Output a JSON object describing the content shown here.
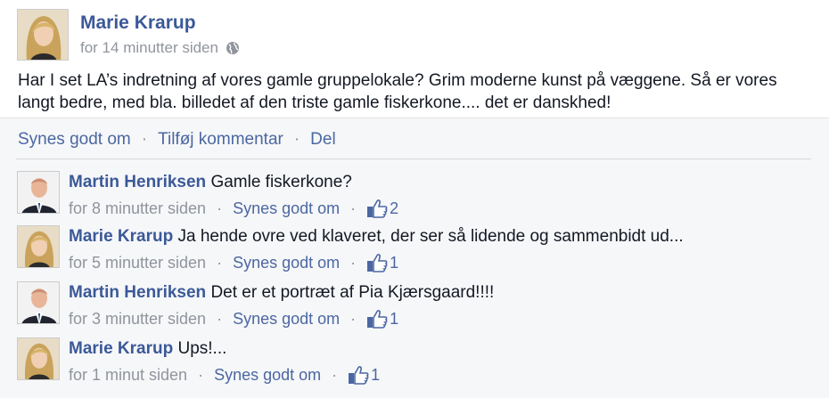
{
  "post": {
    "author": "Marie Krarup",
    "time": "for 14 minutter siden",
    "text": "Har I set LA’s indretning af vores gamle gruppelokale? Grim moderne kunst på væggene. Så er vores langt bedre, med bla. billedet af den triste gamle fiskerkone.... det er danskhed!",
    "privacy_icon": "globe-icon"
  },
  "actions": {
    "like": "Synes godt om",
    "comment": "Tilføj kommentar",
    "share": "Del",
    "separator": "·"
  },
  "comments": [
    {
      "author": "Martin Henriksen",
      "text": "Gamle fiskerkone?",
      "time": "for 8 minutter siden",
      "like_label": "Synes godt om",
      "likes": "2"
    },
    {
      "author": "Marie Krarup",
      "text": "Ja hende ovre ved klaveret, der ser så lidende og sammenbidt ud...",
      "time": "for 5 minutter siden",
      "like_label": "Synes godt om",
      "likes": "1"
    },
    {
      "author": "Martin Henriksen",
      "text": "Det er et portræt af Pia Kjærsgaard!!!!",
      "time": "for 3 minutter siden",
      "like_label": "Synes godt om",
      "likes": "1"
    },
    {
      "author": "Marie Krarup",
      "text": "Ups!...",
      "time": "for 1 minut siden",
      "like_label": "Synes godt om",
      "likes": "1"
    }
  ],
  "colors": {
    "link": "#3b5998",
    "muted": "#90949c",
    "action_bg": "#f6f7f9"
  }
}
